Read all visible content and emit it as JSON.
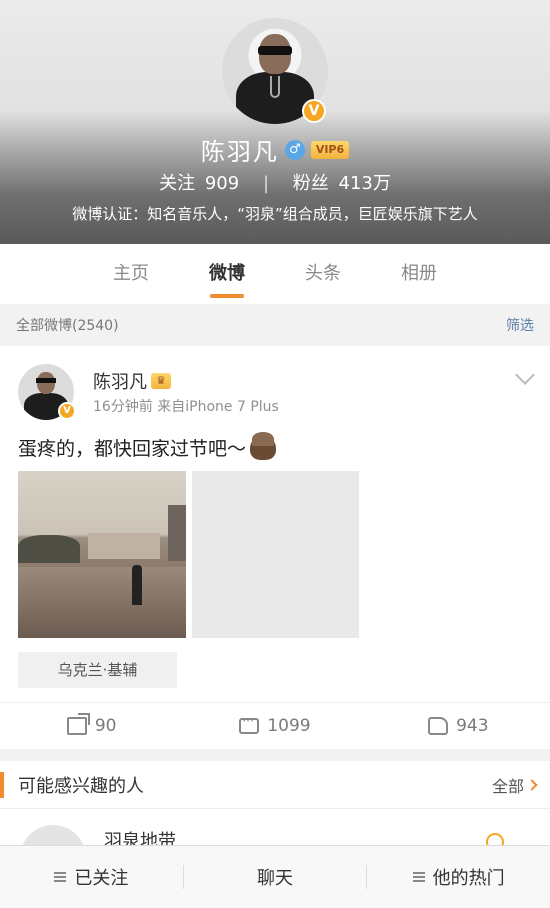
{
  "profile": {
    "name": "陈羽凡",
    "gender_icon": "♂",
    "vip_label": "VIP6",
    "verified_badge": "V",
    "stats": {
      "following_label": "关注",
      "following_count": "909",
      "separator": "|",
      "fans_label": "粉丝",
      "fans_count": "413万"
    },
    "verification": "微博认证：知名音乐人，“羽泉”组合成员，巨匠娱乐旗下艺人"
  },
  "tabs": [
    {
      "label": "主页"
    },
    {
      "label": "微博"
    },
    {
      "label": "头条"
    },
    {
      "label": "相册"
    }
  ],
  "filter_bar": {
    "all_posts": "全部微博(2540)",
    "filter": "筛选"
  },
  "post": {
    "author": "陈羽凡",
    "meta": "16分钟前  来自iPhone 7 Plus",
    "text": "蛋疼的，都快回家过节吧～",
    "location": "乌克兰·基辅",
    "actions": {
      "repost_count": "90",
      "comment_count": "1099",
      "like_count": "943"
    }
  },
  "suggest": {
    "title": "可能感兴趣的人",
    "all_label": "全部",
    "people": [
      {
        "name": "羽泉地带"
      }
    ]
  },
  "bottom_bar": {
    "followed": "已关注",
    "chat": "聊天",
    "hot": "他的热门"
  },
  "colors": {
    "accent": "#f28a2e",
    "verified": "#f5a623",
    "link": "#5b7fa6"
  }
}
